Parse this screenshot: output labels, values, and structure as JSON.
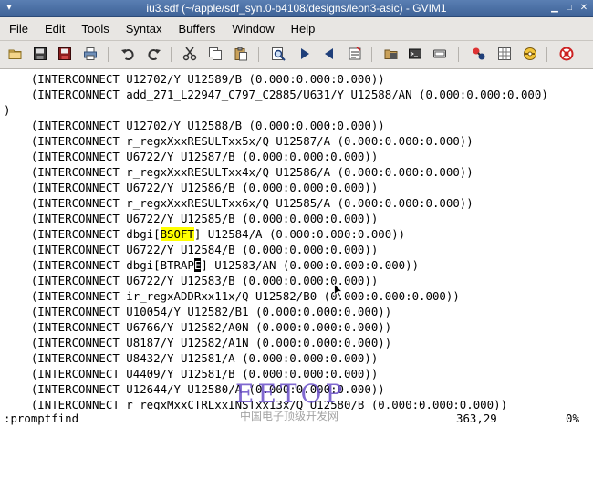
{
  "window": {
    "title": "iu3.sdf (~/apple/sdf_syn.0-b4108/designs/leon3-asic) - GVIM1",
    "menu_glyph": "▾",
    "minimize_glyph": "▁",
    "maximize_glyph": "□",
    "close_glyph": "✕"
  },
  "menubar": {
    "items": [
      "File",
      "Edit",
      "Tools",
      "Syntax",
      "Buffers",
      "Window",
      "Help"
    ]
  },
  "toolbar": {
    "icons": [
      "open-icon",
      "save-icon",
      "save-all-icon",
      "print-icon",
      "undo-icon",
      "redo-icon",
      "cut-icon",
      "copy-icon",
      "paste-icon",
      "find-icon",
      "find-next-icon",
      "find-prev-icon",
      "load-session-icon",
      "save-session-icon",
      "run-script-icon",
      "make-icon",
      "build-tags-icon",
      "jump-tag-icon",
      "help-icon",
      "find-help-icon"
    ]
  },
  "editor": {
    "lines": [
      "    (INTERCONNECT U12702/Y U12589/B (0.000:0.000:0.000))",
      "    (INTERCONNECT add_271_L22947_C797_C2885/U631/Y U12588/AN (0.000:0.000:0.000)",
      ")",
      "    (INTERCONNECT U12702/Y U12588/B (0.000:0.000:0.000))",
      "    (INTERCONNECT r_regxXxxRESULTxx5x/Q U12587/A (0.000:0.000:0.000))",
      "    (INTERCONNECT U6722/Y U12587/B (0.000:0.000:0.000))",
      "    (INTERCONNECT r_regxXxxRESULTxx4x/Q U12586/A (0.000:0.000:0.000))",
      "    (INTERCONNECT U6722/Y U12586/B (0.000:0.000:0.000))",
      "    (INTERCONNECT r_regxXxxRESULTxx6x/Q U12585/A (0.000:0.000:0.000))",
      "    (INTERCONNECT U6722/Y U12585/B (0.000:0.000:0.000))",
      "    (INTERCONNECT dbgi[BSOFT] U12584/A (0.000:0.000:0.000))",
      "    (INTERCONNECT U6722/Y U12584/B (0.000:0.000:0.000))",
      "    (INTERCONNECT dbgi[BTRAPE] U12583/AN (0.000:0.000:0.000))",
      "    (INTERCONNECT U6722/Y U12583/B (0.000:0.000:0.000))",
      "    (INTERCONNECT ir_regxADDRxx11x/Q U12582/B0 (0.000:0.000:0.000))",
      "    (INTERCONNECT U10054/Y U12582/B1 (0.000:0.000:0.000))",
      "    (INTERCONNECT U6766/Y U12582/A0N (0.000:0.000:0.000))",
      "    (INTERCONNECT U8187/Y U12582/A1N (0.000:0.000:0.000))",
      "    (INTERCONNECT U8432/Y U12581/A (0.000:0.000:0.000))",
      "    (INTERCONNECT U4409/Y U12581/B (0.000:0.000:0.000))",
      "    (INTERCONNECT U12644/Y U12580/A (0.000:0.000:0.000))",
      "    (INTERCONNECT r_regxMxxCTRLxxINSTxx13x/Q U12580/B (0.000:0.000:0.000))"
    ],
    "search_highlight": {
      "line": 10,
      "prefix": "    (INTERCONNECT dbgi[",
      "match": "BSOFT",
      "suffix": "] U12584/A (0.000:0.000:0.000))"
    },
    "cursor_line": {
      "line": 12,
      "prefix": "    (INTERCONNECT dbgi[BTRAP",
      "cursor_char": "E",
      "suffix": "] U12583/AN (0.000:0.000:0.000))"
    }
  },
  "cmdline": {
    "command": ":promptfind",
    "position": "363,29",
    "percent": "0%"
  },
  "watermark": {
    "logo": "EETOP",
    "subtitle": "中国电子顶级开发网"
  }
}
